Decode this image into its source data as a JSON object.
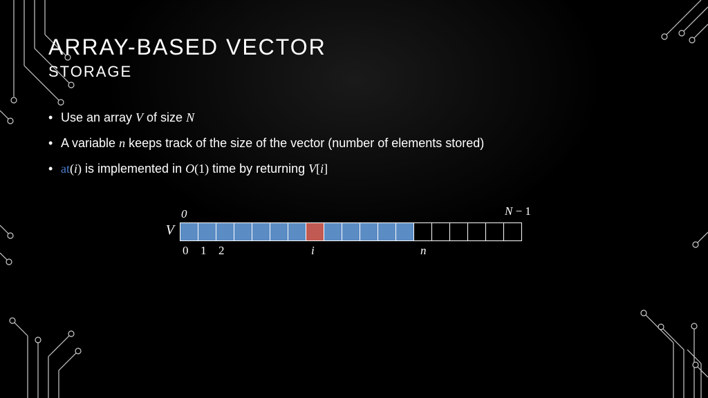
{
  "title": "ARRAY-BASED VECTOR",
  "subtitle": "STORAGE",
  "bullets": {
    "b1": {
      "t1": "Use an array ",
      "var1": "V",
      "t2": " of size ",
      "var2": "N"
    },
    "b2": {
      "t1": "A variable ",
      "var1": "n",
      "t2": " keeps track of the size of the vector (number of elements stored)"
    },
    "b3": {
      "fn": "at",
      "p1": "(",
      "arg": "i",
      "p2": ")",
      "t1": " is implemented in ",
      "o": "O",
      "p3": "(1)",
      "t2": " time by returning ",
      "v": "V",
      "br1": "[",
      "idx": "i",
      "br2": "]"
    }
  },
  "diagram": {
    "array_label": "V",
    "top_zero": "0",
    "top_right": {
      "n": "N",
      "minus": " − 1"
    },
    "bottom": {
      "l0": "0",
      "l1": "1",
      "l2": "2",
      "li": "i",
      "ln": "n"
    },
    "cells": [
      "filled",
      "filled",
      "filled",
      "filled",
      "filled",
      "filled",
      "filled",
      "highlight",
      "filled",
      "filled",
      "filled",
      "filled",
      "filled",
      "empty",
      "empty",
      "empty",
      "empty",
      "empty",
      "empty"
    ]
  }
}
